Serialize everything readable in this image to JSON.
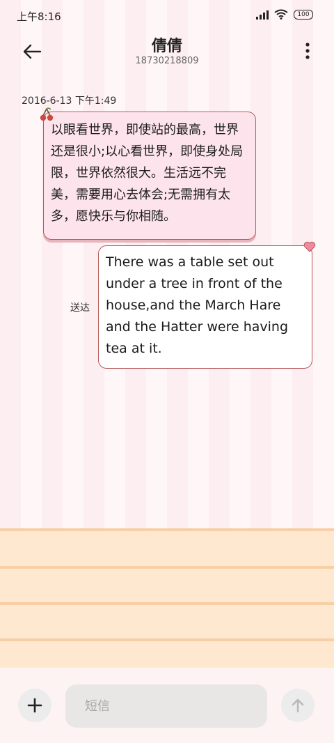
{
  "status_bar": {
    "time": "上午8:16",
    "battery": "100",
    "icons": [
      "signal-icon",
      "wifi-icon",
      "battery-icon"
    ]
  },
  "header": {
    "contact_name": "倩倩",
    "contact_number": "18730218809",
    "icons": [
      "back-arrow-icon",
      "more-vertical-icon"
    ]
  },
  "conversation": {
    "timestamp": "2016-6-13 下午1:49",
    "messages": [
      {
        "direction": "incoming",
        "text": "以眼看世界，即使站的最高，世界还是很小;以心看世界，即使身处局限，世界依然很大。生活远不完美，需要用心去体会;无需拥有太多，愿快乐与你相随。"
      },
      {
        "direction": "outgoing",
        "text": "There was a table set out under a tree in front of the house,and the March Hare and the Hatter were having tea at it.",
        "status": "送达"
      }
    ]
  },
  "composer": {
    "placeholder": "短信",
    "value": "",
    "icons": [
      "plus-icon",
      "send-arrow-icon"
    ]
  },
  "colors": {
    "bubble_border": "#b65a5a",
    "incoming_bubble": "#fde4ec",
    "outgoing_bubble": "#ffffff",
    "paper": "#ffe8d0"
  }
}
